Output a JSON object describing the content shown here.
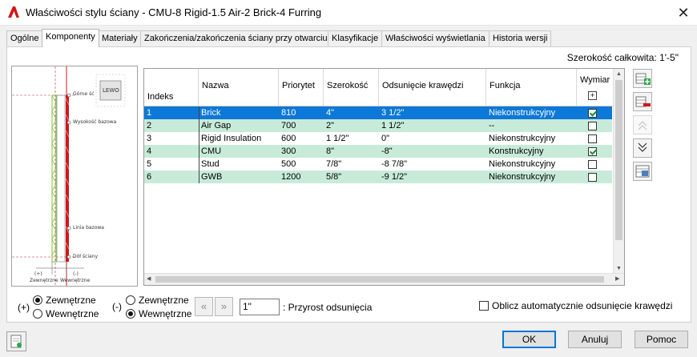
{
  "window": {
    "title": "Właściwości stylu ściany - CMU-8 Rigid-1.5 Air-2 Brick-4 Furring",
    "close_glyph": "✕"
  },
  "tabs": [
    {
      "label": "Ogólne",
      "active": false
    },
    {
      "label": "Komponenty",
      "active": true
    },
    {
      "label": "Materiały",
      "active": false
    },
    {
      "label": "Zakończenia/zakończenia ściany przy otwarciu",
      "active": false
    },
    {
      "label": "Klasyfikacje",
      "active": false
    },
    {
      "label": "Właściwości wyświetlania",
      "active": false
    },
    {
      "label": "Historia wersji",
      "active": false
    }
  ],
  "total_width": "Szerokość całkowita: 1'-5\"",
  "preview": {
    "viewcube_label": "LEWO",
    "labels": {
      "top_edge": "Górne ść",
      "base_height": "Wysokość bazowa",
      "baseline": "Linia bazowa",
      "bottom_edge": "Dół ściany",
      "exterior_sign": "(+)",
      "interior_sign": "(-)",
      "exterior": "Zewnętrzne",
      "interior": "Wewnętrzne"
    }
  },
  "table": {
    "columns": [
      "Indeks",
      "Nazwa",
      "Priorytet",
      "Szerokość",
      "Odsunięcie krawędzi",
      "Funkcja",
      "Wymiar"
    ],
    "rows": [
      {
        "index": "1",
        "name": "Brick",
        "priority": "810",
        "width": "4\"",
        "offset": "3 1/2\"",
        "function": "Niekonstrukcyjny",
        "dim": true,
        "selected": true
      },
      {
        "index": "2",
        "name": "Air Gap",
        "priority": "700",
        "width": "2\"",
        "offset": "1 1/2\"",
        "function": "--",
        "dim": false,
        "selected": false
      },
      {
        "index": "3",
        "name": "Rigid Insulation",
        "priority": "600",
        "width": "1 1/2\"",
        "offset": "0\"",
        "function": "Niekonstrukcyjny",
        "dim": false,
        "selected": false
      },
      {
        "index": "4",
        "name": "CMU",
        "priority": "300",
        "width": "8\"",
        "offset": "-8\"",
        "function": "Konstrukcyjny",
        "dim": true,
        "selected": false
      },
      {
        "index": "5",
        "name": "Stud",
        "priority": "500",
        "width": "7/8\"",
        "offset": "-8 7/8\"",
        "function": "Niekonstrukcyjny",
        "dim": false,
        "selected": false
      },
      {
        "index": "6",
        "name": "GWB",
        "priority": "1200",
        "width": "5/8\"",
        "offset": "-9 1/2\"",
        "function": "Niekonstrukcyjny",
        "dim": false,
        "selected": false
      }
    ]
  },
  "offset_controls": {
    "group1": {
      "sign": "(+)",
      "opt_exterior": "Zewnętrzne",
      "opt_interior": "Wewnętrzne",
      "selected": "exterior"
    },
    "group2": {
      "sign": "(-)",
      "opt_exterior": "Zewnętrzne",
      "opt_interior": "Wewnętrzne",
      "selected": "interior"
    },
    "arrow_left": "«",
    "arrow_right": "»",
    "increment_value": "1\"",
    "increment_label": ": Przyrost odsunięcia",
    "auto_calc_label": "Oblicz automatycznie odsunięcie krawędzi",
    "auto_calc_checked": false
  },
  "buttons": {
    "ok": "OK",
    "cancel": "Anuluj",
    "help": "Pomoc"
  },
  "colors": {
    "selection": "#0c78d7",
    "alt_row": "#c8ebd9",
    "accent_red": "#d01818"
  }
}
